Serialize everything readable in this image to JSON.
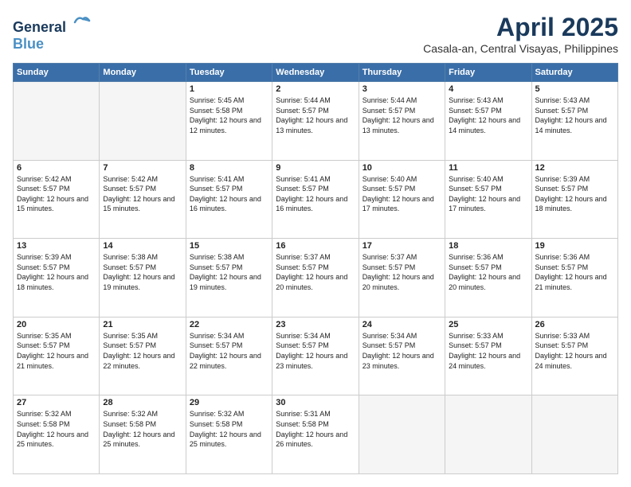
{
  "header": {
    "logo_line1": "General",
    "logo_line2": "Blue",
    "month": "April 2025",
    "location": "Casala-an, Central Visayas, Philippines"
  },
  "weekdays": [
    "Sunday",
    "Monday",
    "Tuesday",
    "Wednesday",
    "Thursday",
    "Friday",
    "Saturday"
  ],
  "weeks": [
    [
      {
        "day": "",
        "sunrise": "",
        "sunset": "",
        "daylight": ""
      },
      {
        "day": "",
        "sunrise": "",
        "sunset": "",
        "daylight": ""
      },
      {
        "day": "1",
        "sunrise": "Sunrise: 5:45 AM",
        "sunset": "Sunset: 5:58 PM",
        "daylight": "Daylight: 12 hours and 12 minutes."
      },
      {
        "day": "2",
        "sunrise": "Sunrise: 5:44 AM",
        "sunset": "Sunset: 5:57 PM",
        "daylight": "Daylight: 12 hours and 13 minutes."
      },
      {
        "day": "3",
        "sunrise": "Sunrise: 5:44 AM",
        "sunset": "Sunset: 5:57 PM",
        "daylight": "Daylight: 12 hours and 13 minutes."
      },
      {
        "day": "4",
        "sunrise": "Sunrise: 5:43 AM",
        "sunset": "Sunset: 5:57 PM",
        "daylight": "Daylight: 12 hours and 14 minutes."
      },
      {
        "day": "5",
        "sunrise": "Sunrise: 5:43 AM",
        "sunset": "Sunset: 5:57 PM",
        "daylight": "Daylight: 12 hours and 14 minutes."
      }
    ],
    [
      {
        "day": "6",
        "sunrise": "Sunrise: 5:42 AM",
        "sunset": "Sunset: 5:57 PM",
        "daylight": "Daylight: 12 hours and 15 minutes."
      },
      {
        "day": "7",
        "sunrise": "Sunrise: 5:42 AM",
        "sunset": "Sunset: 5:57 PM",
        "daylight": "Daylight: 12 hours and 15 minutes."
      },
      {
        "day": "8",
        "sunrise": "Sunrise: 5:41 AM",
        "sunset": "Sunset: 5:57 PM",
        "daylight": "Daylight: 12 hours and 16 minutes."
      },
      {
        "day": "9",
        "sunrise": "Sunrise: 5:41 AM",
        "sunset": "Sunset: 5:57 PM",
        "daylight": "Daylight: 12 hours and 16 minutes."
      },
      {
        "day": "10",
        "sunrise": "Sunrise: 5:40 AM",
        "sunset": "Sunset: 5:57 PM",
        "daylight": "Daylight: 12 hours and 17 minutes."
      },
      {
        "day": "11",
        "sunrise": "Sunrise: 5:40 AM",
        "sunset": "Sunset: 5:57 PM",
        "daylight": "Daylight: 12 hours and 17 minutes."
      },
      {
        "day": "12",
        "sunrise": "Sunrise: 5:39 AM",
        "sunset": "Sunset: 5:57 PM",
        "daylight": "Daylight: 12 hours and 18 minutes."
      }
    ],
    [
      {
        "day": "13",
        "sunrise": "Sunrise: 5:39 AM",
        "sunset": "Sunset: 5:57 PM",
        "daylight": "Daylight: 12 hours and 18 minutes."
      },
      {
        "day": "14",
        "sunrise": "Sunrise: 5:38 AM",
        "sunset": "Sunset: 5:57 PM",
        "daylight": "Daylight: 12 hours and 19 minutes."
      },
      {
        "day": "15",
        "sunrise": "Sunrise: 5:38 AM",
        "sunset": "Sunset: 5:57 PM",
        "daylight": "Daylight: 12 hours and 19 minutes."
      },
      {
        "day": "16",
        "sunrise": "Sunrise: 5:37 AM",
        "sunset": "Sunset: 5:57 PM",
        "daylight": "Daylight: 12 hours and 20 minutes."
      },
      {
        "day": "17",
        "sunrise": "Sunrise: 5:37 AM",
        "sunset": "Sunset: 5:57 PM",
        "daylight": "Daylight: 12 hours and 20 minutes."
      },
      {
        "day": "18",
        "sunrise": "Sunrise: 5:36 AM",
        "sunset": "Sunset: 5:57 PM",
        "daylight": "Daylight: 12 hours and 20 minutes."
      },
      {
        "day": "19",
        "sunrise": "Sunrise: 5:36 AM",
        "sunset": "Sunset: 5:57 PM",
        "daylight": "Daylight: 12 hours and 21 minutes."
      }
    ],
    [
      {
        "day": "20",
        "sunrise": "Sunrise: 5:35 AM",
        "sunset": "Sunset: 5:57 PM",
        "daylight": "Daylight: 12 hours and 21 minutes."
      },
      {
        "day": "21",
        "sunrise": "Sunrise: 5:35 AM",
        "sunset": "Sunset: 5:57 PM",
        "daylight": "Daylight: 12 hours and 22 minutes."
      },
      {
        "day": "22",
        "sunrise": "Sunrise: 5:34 AM",
        "sunset": "Sunset: 5:57 PM",
        "daylight": "Daylight: 12 hours and 22 minutes."
      },
      {
        "day": "23",
        "sunrise": "Sunrise: 5:34 AM",
        "sunset": "Sunset: 5:57 PM",
        "daylight": "Daylight: 12 hours and 23 minutes."
      },
      {
        "day": "24",
        "sunrise": "Sunrise: 5:34 AM",
        "sunset": "Sunset: 5:57 PM",
        "daylight": "Daylight: 12 hours and 23 minutes."
      },
      {
        "day": "25",
        "sunrise": "Sunrise: 5:33 AM",
        "sunset": "Sunset: 5:57 PM",
        "daylight": "Daylight: 12 hours and 24 minutes."
      },
      {
        "day": "26",
        "sunrise": "Sunrise: 5:33 AM",
        "sunset": "Sunset: 5:57 PM",
        "daylight": "Daylight: 12 hours and 24 minutes."
      }
    ],
    [
      {
        "day": "27",
        "sunrise": "Sunrise: 5:32 AM",
        "sunset": "Sunset: 5:58 PM",
        "daylight": "Daylight: 12 hours and 25 minutes."
      },
      {
        "day": "28",
        "sunrise": "Sunrise: 5:32 AM",
        "sunset": "Sunset: 5:58 PM",
        "daylight": "Daylight: 12 hours and 25 minutes."
      },
      {
        "day": "29",
        "sunrise": "Sunrise: 5:32 AM",
        "sunset": "Sunset: 5:58 PM",
        "daylight": "Daylight: 12 hours and 25 minutes."
      },
      {
        "day": "30",
        "sunrise": "Sunrise: 5:31 AM",
        "sunset": "Sunset: 5:58 PM",
        "daylight": "Daylight: 12 hours and 26 minutes."
      },
      {
        "day": "",
        "sunrise": "",
        "sunset": "",
        "daylight": ""
      },
      {
        "day": "",
        "sunrise": "",
        "sunset": "",
        "daylight": ""
      },
      {
        "day": "",
        "sunrise": "",
        "sunset": "",
        "daylight": ""
      }
    ]
  ]
}
